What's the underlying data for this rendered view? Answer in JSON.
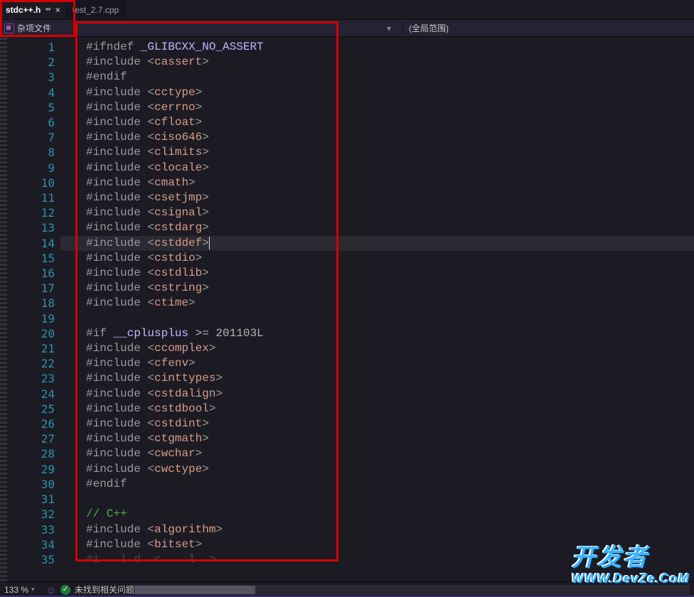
{
  "tabs": {
    "active": {
      "name": "stdc++.h",
      "pinned_glyph": "⇴",
      "close_glyph": "×"
    },
    "inactive": {
      "name": "test_2.7.cpp"
    }
  },
  "sub_bar": {
    "misc_label": "杂项文件",
    "scope_label": "(全局范围)"
  },
  "code_lines": [
    {
      "n": 1,
      "pre": "#ifndef ",
      "rest_sym": "_GLIBCXX_NO_ASSERT"
    },
    {
      "n": 2,
      "pre": "#include ",
      "open": "<",
      "hdr": "cassert",
      "close": ">"
    },
    {
      "n": 3,
      "pre": "#endif"
    },
    {
      "n": 4,
      "pre": "#include ",
      "open": "<",
      "hdr": "cctype",
      "close": ">"
    },
    {
      "n": 5,
      "pre": "#include ",
      "open": "<",
      "hdr": "cerrno",
      "close": ">"
    },
    {
      "n": 6,
      "pre": "#include ",
      "open": "<",
      "hdr": "cfloat",
      "close": ">"
    },
    {
      "n": 7,
      "pre": "#include ",
      "open": "<",
      "hdr": "ciso646",
      "close": ">"
    },
    {
      "n": 8,
      "pre": "#include ",
      "open": "<",
      "hdr": "climits",
      "close": ">"
    },
    {
      "n": 9,
      "pre": "#include ",
      "open": "<",
      "hdr": "clocale",
      "close": ">"
    },
    {
      "n": 10,
      "pre": "#include ",
      "open": "<",
      "hdr": "cmath",
      "close": ">"
    },
    {
      "n": 11,
      "pre": "#include ",
      "open": "<",
      "hdr": "csetjmp",
      "close": ">"
    },
    {
      "n": 12,
      "pre": "#include ",
      "open": "<",
      "hdr": "csignal",
      "close": ">"
    },
    {
      "n": 13,
      "pre": "#include ",
      "open": "<",
      "hdr": "cstdarg",
      "close": ">"
    },
    {
      "n": 14,
      "pre": "#include ",
      "open": "<",
      "hdr": "cstddef",
      "close": ">",
      "hl": true,
      "caret": true
    },
    {
      "n": 15,
      "pre": "#include ",
      "open": "<",
      "hdr": "cstdio",
      "close": ">"
    },
    {
      "n": 16,
      "pre": "#include ",
      "open": "<",
      "hdr": "cstdlib",
      "close": ">"
    },
    {
      "n": 17,
      "pre": "#include ",
      "open": "<",
      "hdr": "cstring",
      "close": ">"
    },
    {
      "n": 18,
      "pre": "#include ",
      "open": "<",
      "hdr": "ctime",
      "close": ">"
    },
    {
      "n": 19,
      "blank": true
    },
    {
      "n": 20,
      "pre": "#if ",
      "sym": "__cplusplus ",
      "rest_sym": ">= 201103L"
    },
    {
      "n": 21,
      "pre": "#include ",
      "open": "<",
      "hdr": "ccomplex",
      "close": ">"
    },
    {
      "n": 22,
      "pre": "#include ",
      "open": "<",
      "hdr": "cfenv",
      "close": ">"
    },
    {
      "n": 23,
      "pre": "#include ",
      "open": "<",
      "hdr": "cinttypes",
      "close": ">"
    },
    {
      "n": 24,
      "pre": "#include ",
      "open": "<",
      "hdr": "cstdalign",
      "close": ">"
    },
    {
      "n": 25,
      "pre": "#include ",
      "open": "<",
      "hdr": "cstdbool",
      "close": ">"
    },
    {
      "n": 26,
      "pre": "#include ",
      "open": "<",
      "hdr": "cstdint",
      "close": ">"
    },
    {
      "n": 27,
      "pre": "#include ",
      "open": "<",
      "hdr": "ctgmath",
      "close": ">"
    },
    {
      "n": 28,
      "pre": "#include ",
      "open": "<",
      "hdr": "cwchar",
      "close": ">"
    },
    {
      "n": 29,
      "pre": "#include ",
      "open": "<",
      "hdr": "cwctype",
      "close": ">"
    },
    {
      "n": 30,
      "pre": "#endif"
    },
    {
      "n": 31,
      "blank": true
    },
    {
      "n": 32,
      "cmt": "// C++"
    },
    {
      "n": 33,
      "pre": "#include ",
      "open": "<",
      "hdr": "algorithm",
      "close": ">"
    },
    {
      "n": 34,
      "pre": "#include ",
      "open": "<",
      "hdr": "bitset",
      "close": ">"
    },
    {
      "n": 35,
      "pre": "#include ",
      "hdr_partial": "complex",
      "cut": true
    }
  ],
  "status": {
    "zoom": "133 %",
    "issues": "未找到相关问题",
    "ok_glyph": "✓"
  },
  "watermark": {
    "line1": "开发者",
    "line2": "WWW.DevZe.CoM"
  },
  "colors": {
    "accent_red": "#d60000"
  }
}
